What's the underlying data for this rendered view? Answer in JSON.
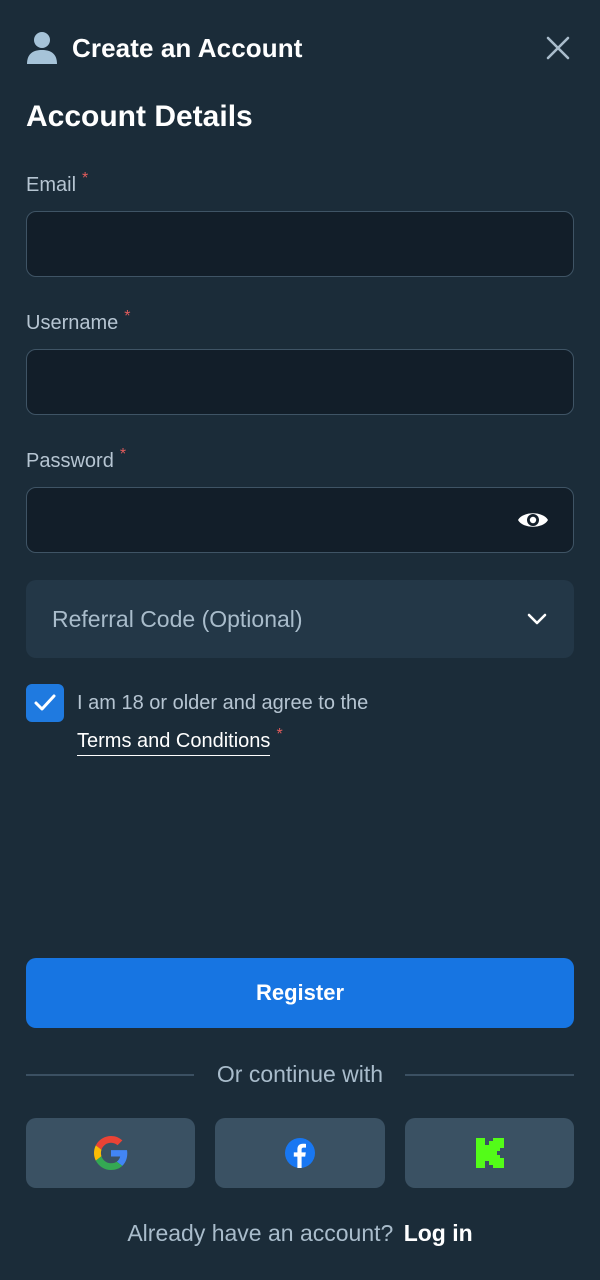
{
  "header": {
    "title": "Create an Account",
    "user_icon": "user-icon",
    "close_icon": "close-icon"
  },
  "section_title": "Account Details",
  "fields": {
    "email": {
      "label": "Email",
      "required": "*",
      "value": "",
      "placeholder": ""
    },
    "username": {
      "label": "Username",
      "required": "*",
      "value": "",
      "placeholder": ""
    },
    "password": {
      "label": "Password",
      "required": "*",
      "value": "",
      "placeholder": "",
      "toggle_icon": "eye-icon"
    }
  },
  "referral": {
    "label": "Referral Code (Optional)",
    "icon": "chevron-down-icon"
  },
  "agreement": {
    "checked": true,
    "text": "I am 18 or older and agree to the",
    "link": "Terms and Conditions",
    "required": "*"
  },
  "register_label": "Register",
  "divider_text": "Or continue with",
  "social": [
    "google-icon",
    "facebook-icon",
    "kick-icon"
  ],
  "footer": {
    "text": "Already have an account?",
    "link": "Log in"
  },
  "colors": {
    "background": "#1b2c39",
    "accent": "#1775e2",
    "required": "#e25c5c",
    "kick_green": "#53fc18"
  }
}
